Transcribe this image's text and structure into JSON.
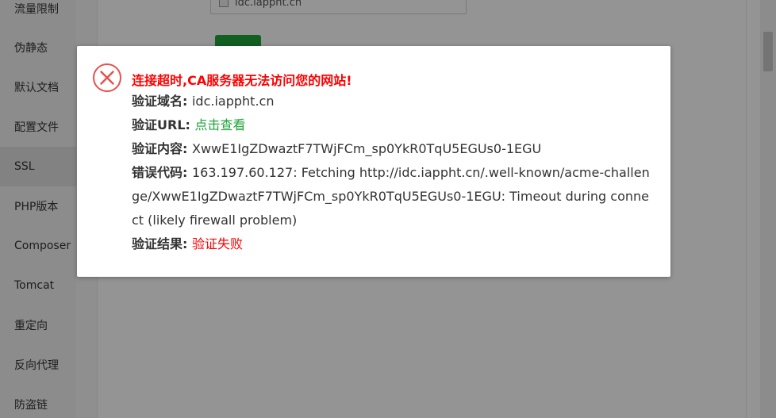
{
  "sidebar": {
    "items": [
      {
        "label": "流量限制"
      },
      {
        "label": "伪静态"
      },
      {
        "label": "默认文档"
      },
      {
        "label": "配置文件"
      },
      {
        "label": "SSL"
      },
      {
        "label": "PHP版本"
      },
      {
        "label": "Composer"
      },
      {
        "label": "Tomcat"
      },
      {
        "label": "重定向"
      },
      {
        "label": "反向代理"
      },
      {
        "label": "防盗链"
      }
    ],
    "active_label": "SSL"
  },
  "main": {
    "domain_checkbox_label": "idc.iappht.cn"
  },
  "dialog": {
    "icon": "error-circle-x-icon",
    "title": "连接超时,CA服务器无法访问您的网站!",
    "rows": {
      "domain": {
        "label": "验证域名:",
        "value": "idc.iappht.cn"
      },
      "url": {
        "label": "验证URL:",
        "value": "点击查看"
      },
      "content": {
        "label": "验证内容:",
        "value": "XwwE1IgZDwaztF7TWjFCm_sp0YkR0TqU5EGUs0-1EGU"
      },
      "error": {
        "label": "错误代码:",
        "value": "163.197.60.127: Fetching http://idc.iappht.cn/.well-known/acme-challenge/XwwE1IgZDwaztF7TWjFCm_sp0YkR0TqU5EGUs0-1EGU: Timeout during connect (likely firewall problem)"
      },
      "result": {
        "label": "验证结果:",
        "value": "验证失败"
      }
    }
  },
  "colors": {
    "error_red": "#ff0000",
    "link_green": "#20a53a",
    "icon_red": "#e8504a",
    "text": "#333333",
    "sidebar_bg": "#f2f2f2"
  }
}
